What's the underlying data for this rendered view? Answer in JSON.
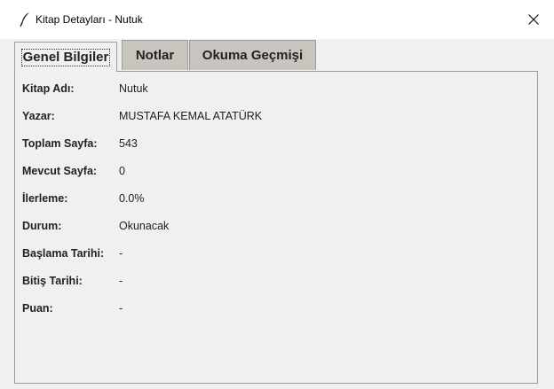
{
  "window": {
    "title": "Kitap Detayları - Nutuk",
    "icon": "feather-icon",
    "close_icon": "close-icon"
  },
  "tabs": [
    {
      "label": "Genel Bilgiler",
      "active": true
    },
    {
      "label": "Notlar",
      "active": false
    },
    {
      "label": "Okuma Geçmişi",
      "active": false
    }
  ],
  "details": [
    {
      "label": "Kitap Adı:",
      "value": "Nutuk"
    },
    {
      "label": "Yazar:",
      "value": "MUSTAFA KEMAL ATATÜRK"
    },
    {
      "label": "Toplam Sayfa:",
      "value": "543"
    },
    {
      "label": "Mevcut Sayfa:",
      "value": "0"
    },
    {
      "label": "İlerleme:",
      "value": "0.0%"
    },
    {
      "label": "Durum:",
      "value": "Okunacak"
    },
    {
      "label": "Başlama Tarihi:",
      "value": "-"
    },
    {
      "label": "Bitiş Tarihi:",
      "value": "-"
    },
    {
      "label": "Puan:",
      "value": "-"
    }
  ]
}
